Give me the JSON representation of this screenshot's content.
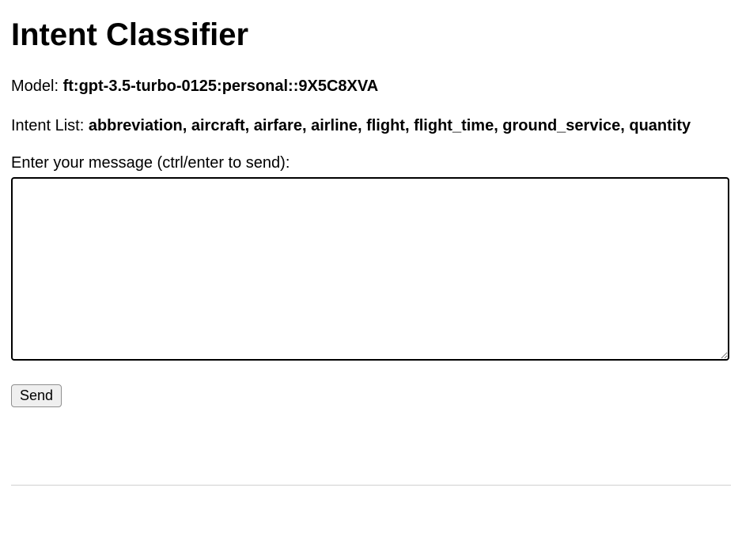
{
  "header": {
    "title": "Intent Classifier"
  },
  "model_line": {
    "label": "Model: ",
    "value": "ft:gpt-3.5-turbo-0125:personal::9X5C8XVA"
  },
  "intent_line": {
    "label": "Intent List: ",
    "value": "abbreviation, aircraft, airfare, airline, flight, flight_time, ground_service, quantity"
  },
  "input": {
    "prompt": "Enter your message (ctrl/enter to send):",
    "value": ""
  },
  "buttons": {
    "send": "Send"
  }
}
